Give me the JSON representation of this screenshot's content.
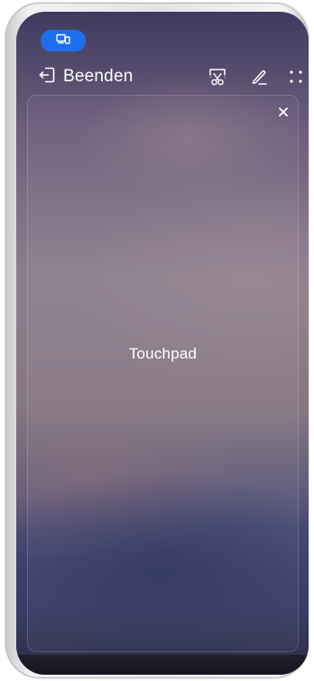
{
  "topbar": {
    "cast_icon": "projection-device-icon",
    "exit_icon": "exit-door-icon",
    "exit_label": "Beenden",
    "tools": [
      {
        "icon": "screenshot-scissors-icon"
      },
      {
        "icon": "pen-annotate-icon"
      },
      {
        "icon": "more-dots-icon"
      }
    ]
  },
  "touchpad": {
    "label": "Touchpad",
    "close_icon": "close-icon"
  },
  "colors": {
    "accent": "#1e6ff0",
    "text": "#ffffff"
  }
}
